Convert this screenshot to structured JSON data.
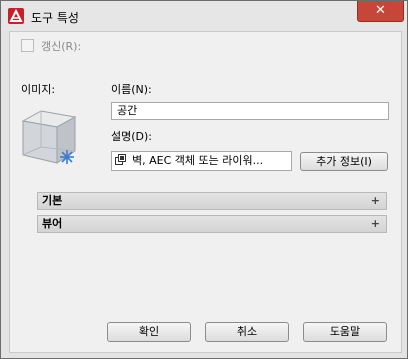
{
  "window": {
    "title": "도구 특성",
    "close_glyph": "✕"
  },
  "refresh": {
    "label": "갱신(R):",
    "checked": false
  },
  "image": {
    "label": "이미지:"
  },
  "name": {
    "label": "이름(N):",
    "value": "공간"
  },
  "description": {
    "label": "설명(D):",
    "value": "벽, AEC 객체 또는 라이워..."
  },
  "more_info": {
    "label": "추가 정보(I)"
  },
  "sections": [
    {
      "label": "기본",
      "expand_glyph": "+"
    },
    {
      "label": "뷰어",
      "expand_glyph": "+"
    }
  ],
  "buttons": {
    "ok": "확인",
    "cancel": "취소",
    "help": "도움말"
  },
  "icons": {
    "app": "autocad-a-icon",
    "preview": "space-cube-icon",
    "description": "objects-icon"
  }
}
